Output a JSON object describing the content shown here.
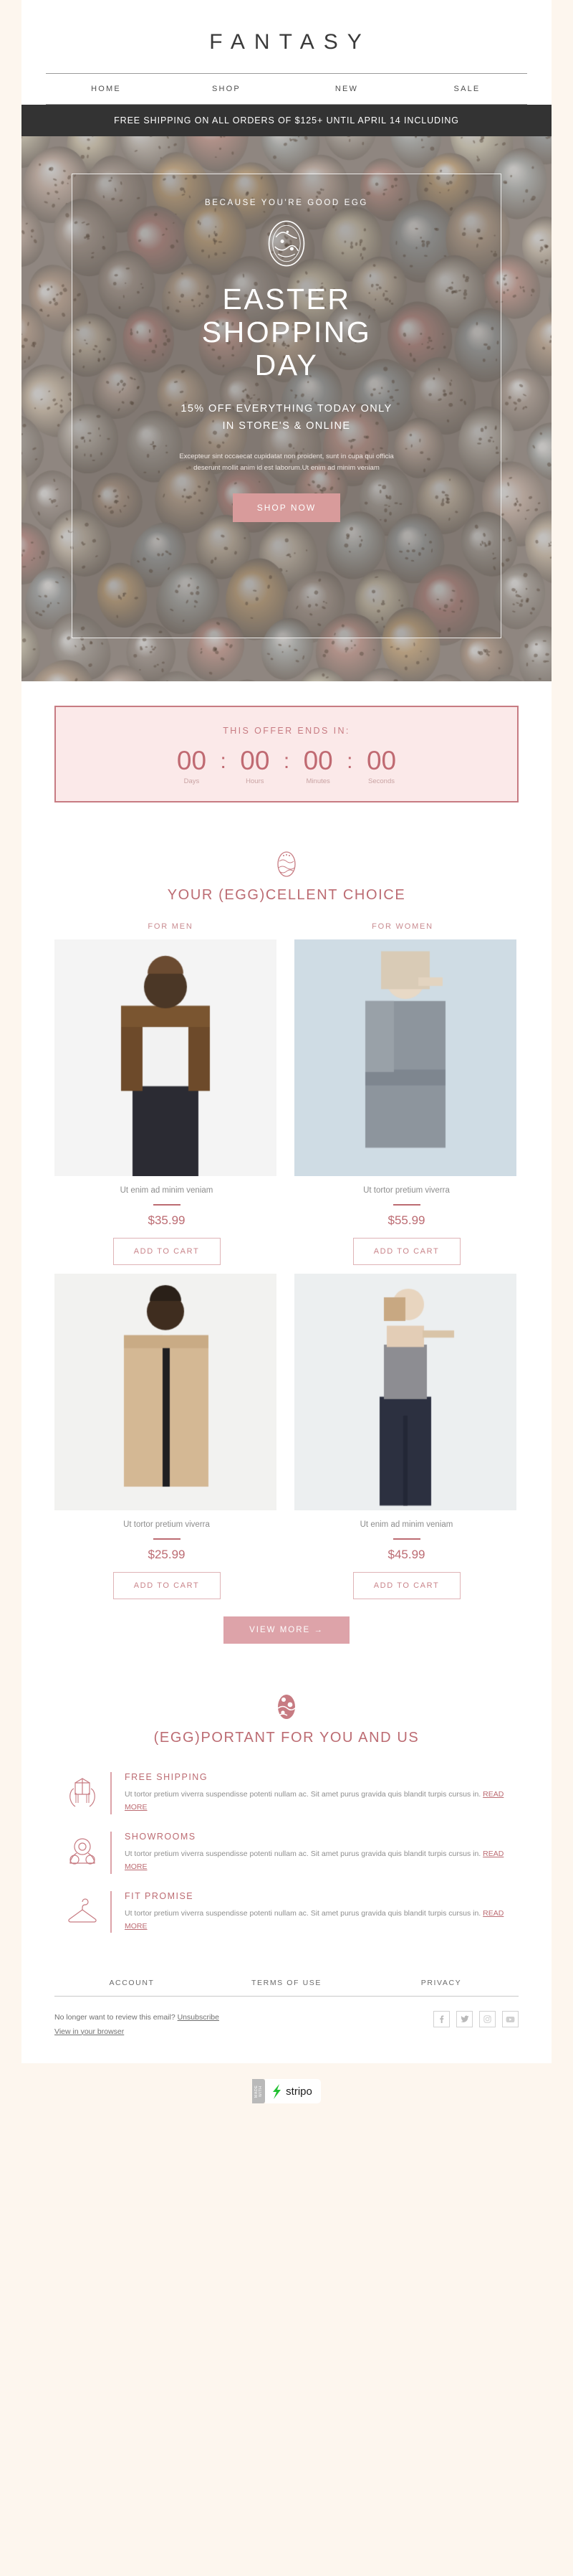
{
  "brand": {
    "name": "FANTASY"
  },
  "nav": {
    "items": [
      "HOME",
      "SHOP",
      "NEW",
      "SALE"
    ]
  },
  "shipping_bar": {
    "text": "FREE SHIPPING ON ALL ORDERS OF $125+ UNTIL APRIL 14 INCLUDING"
  },
  "hero": {
    "kicker": "BECAUSE YOU'RE GOOD EGG",
    "emblem_label": "easter-emblem",
    "title_line1": "EASTER",
    "title_line2": "SHOPPING",
    "title_line3": "DAY",
    "sub_line1": "15% OFF EVERYTHING TODAY ONLY",
    "sub_line2": "IN STORE'S & ONLINE",
    "description": "Excepteur sint occaecat cupidatat non proident, sunt in cupa qui officia deserunt mollit anim id est laborum.Ut enim ad minim veniam",
    "cta": "SHOP NOW"
  },
  "countdown": {
    "label": "THIS OFFER ENDS IN:",
    "units": [
      {
        "value": "00",
        "caption": "Days"
      },
      {
        "value": "00",
        "caption": "Hours"
      },
      {
        "value": "00",
        "caption": "Minutes"
      },
      {
        "value": "00",
        "caption": "Seconds"
      }
    ],
    "separator": ":"
  },
  "products_section": {
    "title": "YOUR (EGG)CELLENT CHOICE",
    "column_headers": [
      "FOR MEN",
      "FOR WOMEN"
    ],
    "add_to_cart_label": "ADD TO CART",
    "view_more_label": "VIEW MORE →",
    "items": [
      {
        "name": "Ut enim ad minim veniam",
        "price": "$35.99",
        "photo": "man-brown-jacket"
      },
      {
        "name": "Ut tortor pretium viverra",
        "price": "$55.99",
        "photo": "woman-grey-coat"
      },
      {
        "name": "Ut tortor pretium viverra",
        "price": "$25.99",
        "photo": "man-beige-coat"
      },
      {
        "name": "Ut enim ad minim veniam",
        "price": "$45.99",
        "photo": "woman-navy-pants"
      }
    ]
  },
  "benefits_section": {
    "title": "(EGG)PORTANT FOR YOU AND US",
    "read_more_label": "READ MORE",
    "items": [
      {
        "icon": "hands-box-icon",
        "title": "FREE SHIPPING",
        "text": "Ut tortor pretium viverra suspendisse potenti nullam ac. Sit amet purus gravida quis blandit turpis cursus in."
      },
      {
        "icon": "location-pin-icon",
        "title": "SHOWROOMS",
        "text": "Ut tortor pretium viverra suspendisse potenti nullam ac. Sit amet purus gravida quis blandit turpis cursus in."
      },
      {
        "icon": "hanger-icon",
        "title": "FIT PROMISE",
        "text": "Ut tortor pretium viverra suspendisse potenti nullam ac. Sit amet purus gravida quis blandit turpis cursus in."
      }
    ]
  },
  "footer": {
    "links": [
      "ACCOUNT",
      "TERMS OF USE",
      "PRIVACY"
    ],
    "unsubscribe_prefix": "No longer want to review this email?",
    "unsubscribe_label": "Unsubscribe",
    "view_browser_label": "View in your browser",
    "socials": [
      "facebook-icon",
      "twitter-icon",
      "instagram-icon",
      "youtube-icon"
    ],
    "badge_made_with": "MADE WITH",
    "badge_name": "stripo"
  },
  "colors": {
    "accent": "#bc6b72",
    "accent_light": "#dda3a9",
    "dark_bar": "#333333",
    "page_bg": "#fdf6ee"
  }
}
